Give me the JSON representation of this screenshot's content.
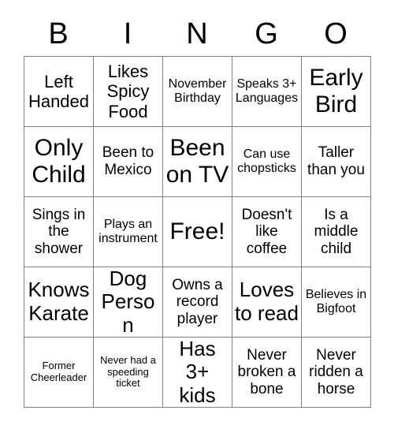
{
  "card": {
    "header_letters": [
      "B",
      "I",
      "N",
      "G",
      "O"
    ],
    "rows": [
      [
        {
          "text": "Left Handed",
          "size": "lg"
        },
        {
          "text": "Likes Spicy Food",
          "size": "lg"
        },
        {
          "text": "November Birthday",
          "size": "sm"
        },
        {
          "text": "Speaks 3+ Languages",
          "size": "sm"
        },
        {
          "text": "Early Bird",
          "size": "xxl"
        }
      ],
      [
        {
          "text": "Only Child",
          "size": "xxl"
        },
        {
          "text": "Been to Mexico",
          "size": "md"
        },
        {
          "text": "Been on TV",
          "size": "xxl"
        },
        {
          "text": "Can use chopsticks",
          "size": "sm"
        },
        {
          "text": "Taller than you",
          "size": "md"
        }
      ],
      [
        {
          "text": "Sings in the shower",
          "size": "md"
        },
        {
          "text": "Plays an instrument",
          "size": "sm"
        },
        {
          "text": "Free!",
          "size": "xxl"
        },
        {
          "text": "Doesn't like coffee",
          "size": "md"
        },
        {
          "text": "Is a middle child",
          "size": "md"
        }
      ],
      [
        {
          "text": "Knows Karate",
          "size": "xl"
        },
        {
          "text": "Dog Person",
          "size": "xl"
        },
        {
          "text": "Owns a record player",
          "size": "md"
        },
        {
          "text": "Loves to read",
          "size": "xl"
        },
        {
          "text": "Believes in Bigfoot",
          "size": "sm"
        }
      ],
      [
        {
          "text": "Former Cheerleader",
          "size": "xs"
        },
        {
          "text": "Never had a speeding ticket",
          "size": "xs"
        },
        {
          "text": "Has 3+ kids",
          "size": "xl"
        },
        {
          "text": "Never broken a bone",
          "size": "md"
        },
        {
          "text": "Never ridden a horse",
          "size": "md"
        }
      ]
    ]
  },
  "colors": {
    "background": "#ffffff",
    "text": "#000000",
    "grid_line": "#808080"
  }
}
